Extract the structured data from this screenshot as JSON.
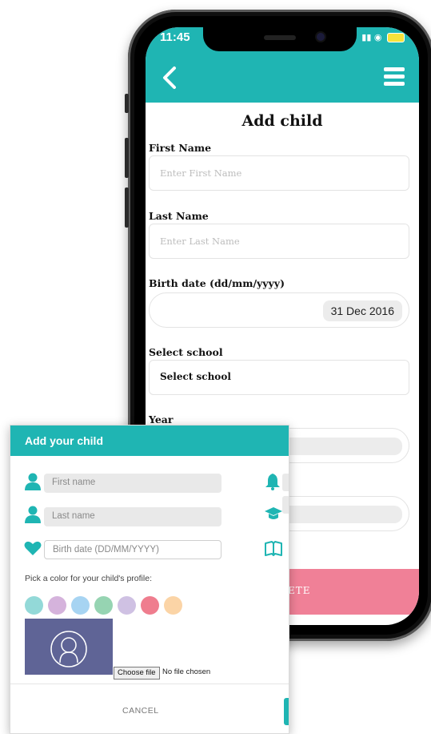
{
  "phone": {
    "status_time": "11:45",
    "title": "Add child",
    "fields": {
      "first_name": {
        "label": "First Name",
        "placeholder": "Enter First Name"
      },
      "last_name": {
        "label": "Last Name",
        "placeholder": "Enter Last Name"
      },
      "birth_date": {
        "label": "Birth date (dd/mm/yyyy)",
        "value": "31 Dec 2016"
      },
      "school": {
        "label": "Select school",
        "value": "Select school"
      },
      "year": {
        "label": "Year"
      }
    },
    "complete_button_partial": "ETE"
  },
  "card": {
    "title": "Add your child",
    "first_name_placeholder": "First name",
    "last_name_placeholder": "Last name",
    "birth_date_placeholder": "Birth date (DD/MM/YYYY)",
    "pick_color_label": "Pick a color for your child's profile:",
    "colors": [
      "#93d9d8",
      "#d5b3dc",
      "#a7d4f2",
      "#96d4b2",
      "#cfc1e3",
      "#ef7d8e",
      "#fbd4a6"
    ],
    "choose_file_label": "Choose file",
    "no_file_label": "No file chosen",
    "cancel_label": "CANCEL"
  },
  "theme": {
    "teal": "#1fb5b3",
    "pink": "#f08097",
    "avatar_bg": "#5f6496"
  },
  "icons": [
    "chevron-left-icon",
    "hamburger-menu-icon",
    "person-icon",
    "heart-icon",
    "bell-icon",
    "graduation-cap-icon",
    "book-icon",
    "avatar-placeholder-icon"
  ]
}
